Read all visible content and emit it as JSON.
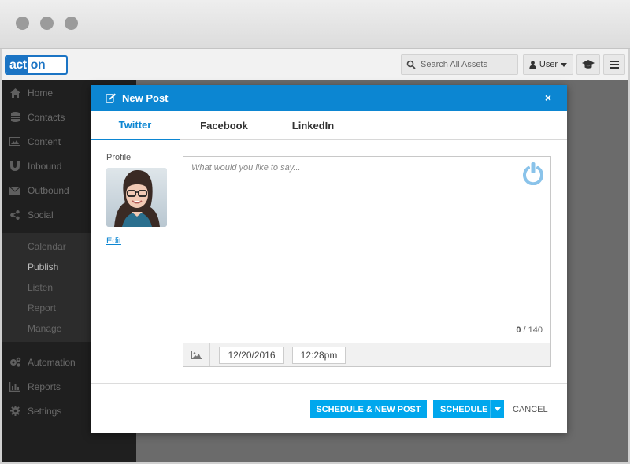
{
  "header": {
    "logo_part1": "act",
    "logo_part2": "on",
    "search_placeholder": "Search All Assets",
    "user_label": "User"
  },
  "sidebar": {
    "items": [
      {
        "label": "Home",
        "icon": "home-icon"
      },
      {
        "label": "Contacts",
        "icon": "database-icon"
      },
      {
        "label": "Content",
        "icon": "image-icon"
      },
      {
        "label": "Inbound",
        "icon": "magnet-icon"
      },
      {
        "label": "Outbound",
        "icon": "envelope-icon"
      },
      {
        "label": "Social",
        "icon": "share-icon"
      }
    ],
    "social_sub": [
      "Calendar",
      "Publish",
      "Listen",
      "Report",
      "Manage"
    ],
    "active_sub": "Publish",
    "bottom_items": [
      {
        "label": "Automation",
        "icon": "cogs-icon"
      },
      {
        "label": "Reports",
        "icon": "bar-chart-icon"
      },
      {
        "label": "Settings",
        "icon": "gear-icon"
      }
    ]
  },
  "modal": {
    "title": "New Post",
    "close_symbol": "×",
    "tabs": [
      "Twitter",
      "Facebook",
      "LinkedIn"
    ],
    "active_tab": "Twitter",
    "profile_label": "Profile",
    "edit_label": "Edit",
    "composer_placeholder": "What would you like to say...",
    "char_count": "0",
    "char_limit": "/ 140",
    "date": "12/20/2016",
    "time": "12:28pm",
    "buttons": {
      "schedule_new": "SCHEDULE & NEW POST",
      "schedule": "SCHEDULE",
      "cancel": "CANCEL"
    }
  },
  "colors": {
    "accent": "#0c86d2",
    "button": "#00a7ed",
    "sidebar_bg": "#1f1f1f"
  }
}
